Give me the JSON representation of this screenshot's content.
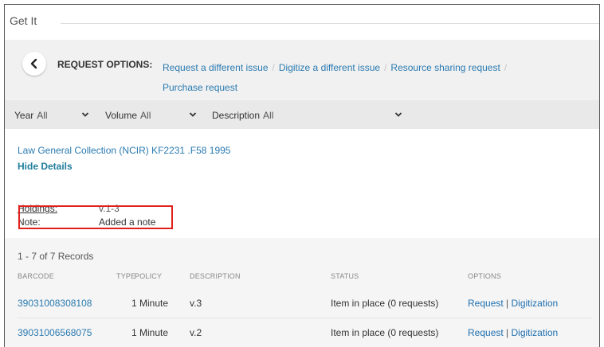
{
  "section": {
    "title": "Get It"
  },
  "request_options": {
    "label": "REQUEST OPTIONS:",
    "links": [
      "Request a different issue",
      "Digitize a different issue",
      "Resource sharing request",
      "Purchase request"
    ]
  },
  "filters": {
    "year": {
      "label": "Year",
      "value": "All"
    },
    "volume": {
      "label": "Volume",
      "value": "All"
    },
    "description": {
      "label": "Description",
      "value": "All"
    }
  },
  "holding": {
    "location": "Law  General Collection (NCIR)  KF2231 .F58 1995",
    "hide_details": "Hide Details",
    "holdings_label": "Holdings:",
    "holdings_value": "v.1-3",
    "note_label": "Note:",
    "note_value": "Added a note"
  },
  "records": {
    "count_text": "1 - 7 of 7 Records",
    "headers": [
      "BARCODE",
      "TYPE",
      "POLICY",
      "DESCRIPTION",
      "STATUS",
      "OPTIONS"
    ],
    "rows": [
      {
        "barcode": "39031008308108",
        "policy": "1 Minute",
        "description": "v.3",
        "status": "Item in place (0 requests)",
        "request": "Request",
        "digitization": "Digitization"
      },
      {
        "barcode": "39031006568075",
        "policy": "1 Minute",
        "description": "v.2",
        "status": "Item in place (0 requests)",
        "request": "Request",
        "digitization": "Digitization"
      }
    ]
  },
  "colors": {
    "link": "#2a7ab0",
    "highlight_box": "#e0201c"
  },
  "icons": {
    "back": "chevron-left-icon",
    "dropdown": "chevron-down-icon"
  }
}
